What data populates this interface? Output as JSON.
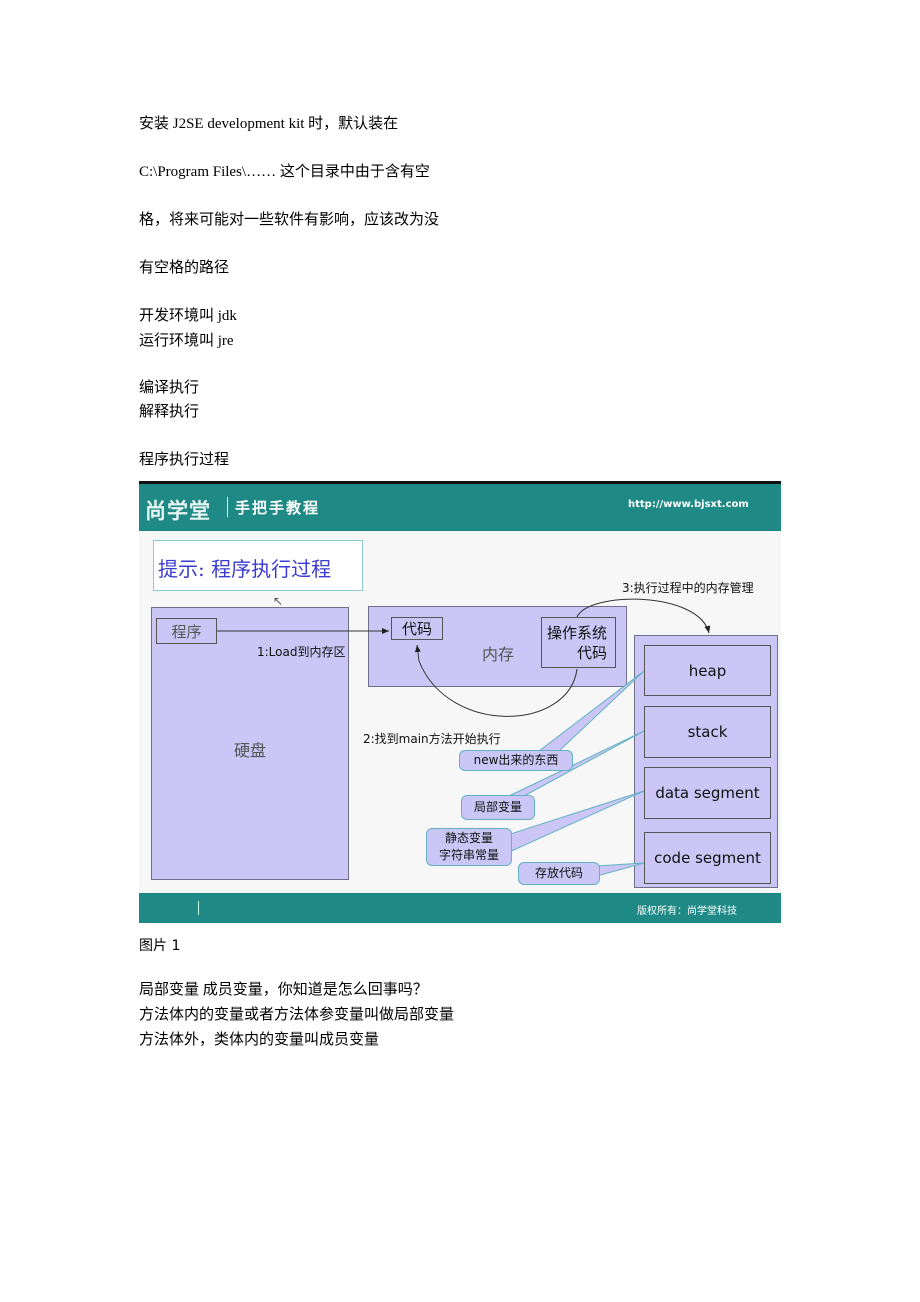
{
  "paragraphs": [
    "安装 J2SE development kit  时，默认装在",
    "C:\\Program Files\\……    这个目录中由于含有空",
    "格，将来可能对一些软件有影响，应该改为没",
    "有空格的路径",
    "开发环境叫 jdk",
    "运行环境叫 jre",
    "编译执行",
    "解释执行",
    "程序执行过程"
  ],
  "figure": {
    "logo": "尚学堂",
    "header_subtitle": "手把手教程",
    "header_url": "http://www.bjsxt.com",
    "hint_title": "提示: 程序执行过程",
    "disk_label": "硬盘",
    "program_label": "程序",
    "memory_label": "内存",
    "code_label": "代码",
    "os_code_label_1": "操作系统",
    "os_code_label_2": "代码",
    "step1": "1:Load到内存区",
    "step2": "2:找到main方法开始执行",
    "step3": "3:执行过程中的内存管理",
    "segments": [
      "heap",
      "stack",
      "data segment",
      "code segment"
    ],
    "callouts": {
      "heap": "new出来的东西",
      "stack": "局部变量",
      "data_1": "静态变量",
      "data_2": "字符串常量",
      "code": "存放代码"
    },
    "footer_copyright": "版权所有：尚学堂科技",
    "colors": {
      "header": "#1f8a85",
      "box_fill": "#cbc6f5",
      "hint_text": "#3b3bd0"
    }
  },
  "caption": "图片 1",
  "after": [
    "局部变量  成员变量，你知道是怎么回事吗？",
    "方法体内的变量或者方法体参变量叫做局部变量",
    "方法体外，类体内的变量叫成员变量"
  ]
}
